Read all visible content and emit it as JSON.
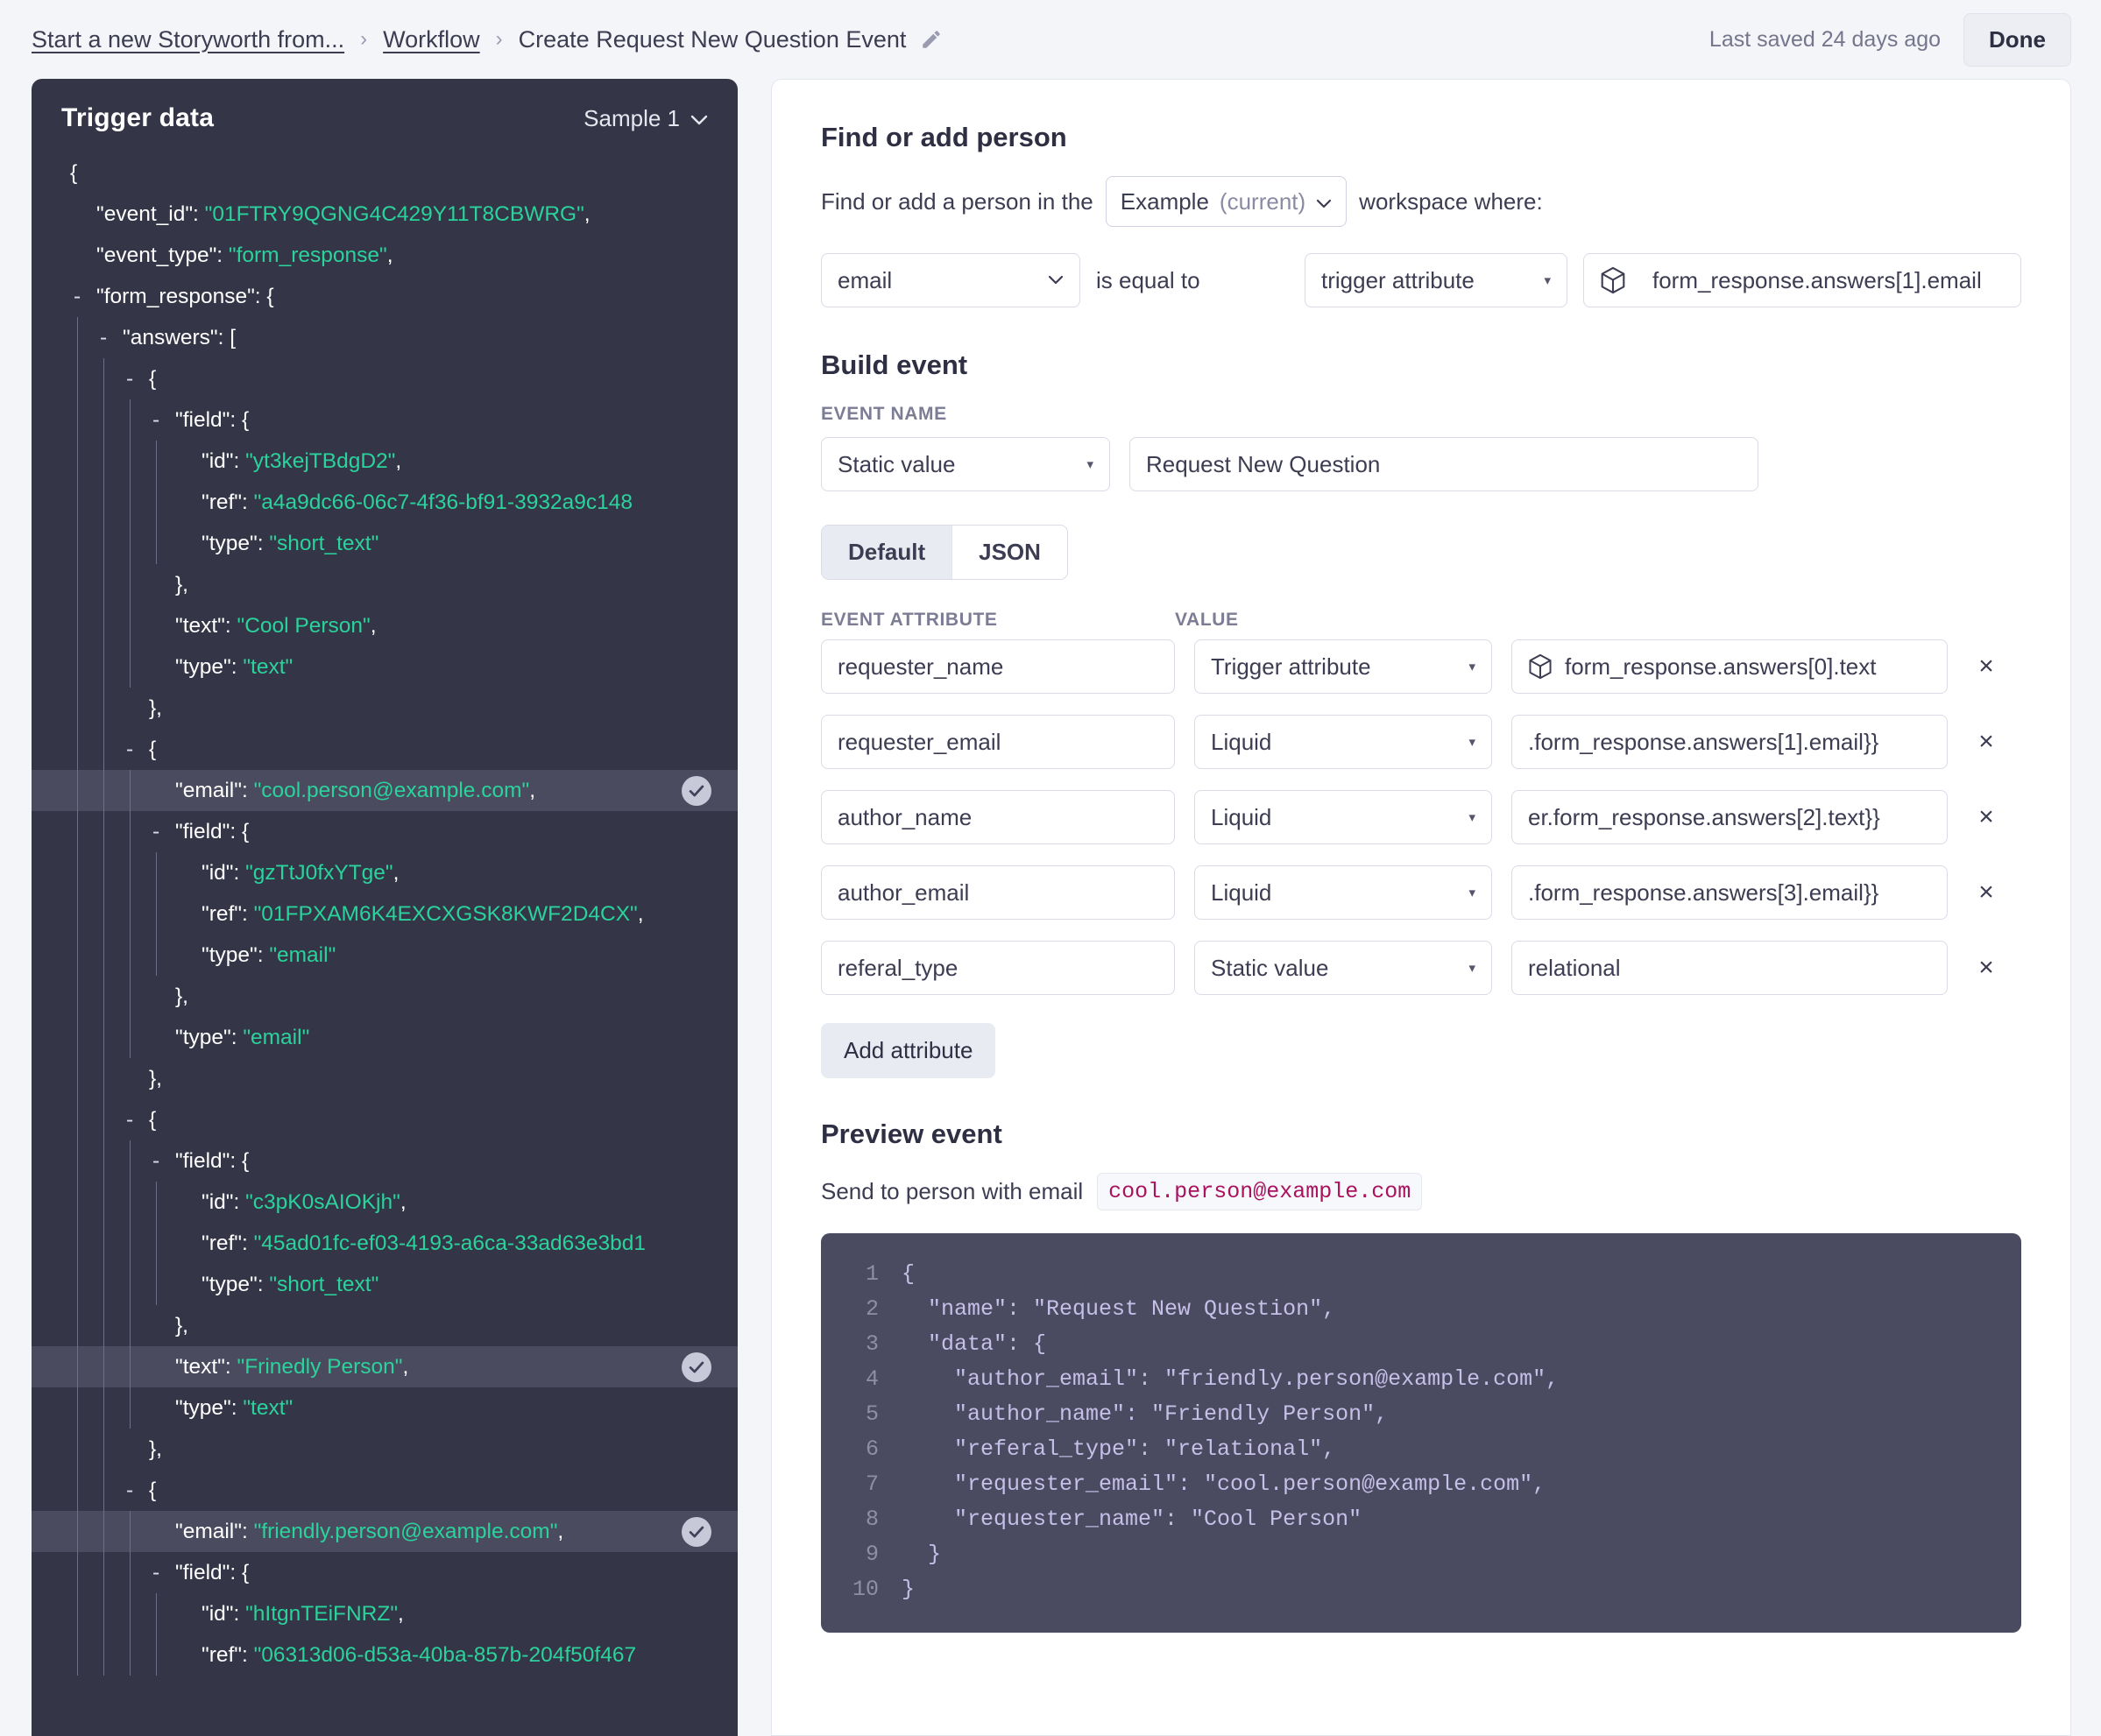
{
  "topbar": {
    "breadcrumb": [
      {
        "label": "Start a new Storyworth from...",
        "link": true
      },
      {
        "label": "Workflow",
        "link": true
      },
      {
        "label": "Create Request New Question Event",
        "link": false
      }
    ],
    "edit_icon": "pencil-icon",
    "saved_status": "Last saved 24 days ago",
    "done_label": "Done"
  },
  "trigger_panel": {
    "title": "Trigger data",
    "sample_label": "Sample 1",
    "chevron": "chevron-down-icon",
    "rows": [
      {
        "guides": 0,
        "dash": false,
        "segments": [
          {
            "t": "{",
            "c": "p"
          }
        ]
      },
      {
        "guides": 1,
        "dash": false,
        "segments": [
          {
            "t": "\"event_id\": ",
            "c": "k"
          },
          {
            "t": "\"01FTRY9QGNG4C429Y11T8CBWRG\"",
            "c": "v"
          },
          {
            "t": ",",
            "c": "p"
          }
        ]
      },
      {
        "guides": 1,
        "dash": false,
        "segments": [
          {
            "t": "\"event_type\": ",
            "c": "k"
          },
          {
            "t": "\"form_response\"",
            "c": "v"
          },
          {
            "t": ",",
            "c": "p"
          }
        ]
      },
      {
        "guides": 1,
        "dash": true,
        "segments": [
          {
            "t": "\"form_response\": {",
            "c": "k"
          }
        ]
      },
      {
        "guides": 2,
        "dash": true,
        "segments": [
          {
            "t": "\"answers\": [",
            "c": "k"
          }
        ]
      },
      {
        "guides": 3,
        "dash": true,
        "segments": [
          {
            "t": "{",
            "c": "p"
          }
        ]
      },
      {
        "guides": 4,
        "dash": true,
        "segments": [
          {
            "t": "\"field\": {",
            "c": "k"
          }
        ]
      },
      {
        "guides": 5,
        "dash": false,
        "segments": [
          {
            "t": "\"id\": ",
            "c": "k"
          },
          {
            "t": "\"yt3kejTBdgD2\"",
            "c": "v"
          },
          {
            "t": ",",
            "c": "p"
          }
        ]
      },
      {
        "guides": 5,
        "dash": false,
        "segments": [
          {
            "t": "\"ref\": ",
            "c": "k"
          },
          {
            "t": "\"a4a9dc66-06c7-4f36-bf91-3932a9c148",
            "c": "v"
          }
        ]
      },
      {
        "guides": 5,
        "dash": false,
        "segments": [
          {
            "t": "\"type\": ",
            "c": "k"
          },
          {
            "t": "\"short_text\"",
            "c": "v"
          }
        ]
      },
      {
        "guides": 4,
        "dash": false,
        "segments": [
          {
            "t": "},",
            "c": "p"
          }
        ]
      },
      {
        "guides": 4,
        "dash": false,
        "segments": [
          {
            "t": "\"text\": ",
            "c": "k"
          },
          {
            "t": "\"Cool Person\"",
            "c": "v"
          },
          {
            "t": ",",
            "c": "p"
          }
        ]
      },
      {
        "guides": 4,
        "dash": false,
        "segments": [
          {
            "t": "\"type\": ",
            "c": "k"
          },
          {
            "t": "\"text\"",
            "c": "v"
          }
        ]
      },
      {
        "guides": 3,
        "dash": false,
        "segments": [
          {
            "t": "},",
            "c": "p"
          }
        ]
      },
      {
        "guides": 3,
        "dash": true,
        "segments": [
          {
            "t": "{",
            "c": "p"
          }
        ]
      },
      {
        "guides": 4,
        "dash": false,
        "highlight": true,
        "check": true,
        "segments": [
          {
            "t": "\"email\": ",
            "c": "k"
          },
          {
            "t": "\"cool.person@example.com\"",
            "c": "v"
          },
          {
            "t": ",",
            "c": "p"
          }
        ]
      },
      {
        "guides": 4,
        "dash": true,
        "segments": [
          {
            "t": "\"field\": {",
            "c": "k"
          }
        ]
      },
      {
        "guides": 5,
        "dash": false,
        "segments": [
          {
            "t": "\"id\": ",
            "c": "k"
          },
          {
            "t": "\"gzTtJ0fxYTge\"",
            "c": "v"
          },
          {
            "t": ",",
            "c": "p"
          }
        ]
      },
      {
        "guides": 5,
        "dash": false,
        "segments": [
          {
            "t": "\"ref\": ",
            "c": "k"
          },
          {
            "t": "\"01FPXAM6K4EXCXGSK8KWF2D4CX\"",
            "c": "v"
          },
          {
            "t": ",",
            "c": "p"
          }
        ]
      },
      {
        "guides": 5,
        "dash": false,
        "segments": [
          {
            "t": "\"type\": ",
            "c": "k"
          },
          {
            "t": "\"email\"",
            "c": "v"
          }
        ]
      },
      {
        "guides": 4,
        "dash": false,
        "segments": [
          {
            "t": "},",
            "c": "p"
          }
        ]
      },
      {
        "guides": 4,
        "dash": false,
        "segments": [
          {
            "t": "\"type\": ",
            "c": "k"
          },
          {
            "t": "\"email\"",
            "c": "v"
          }
        ]
      },
      {
        "guides": 3,
        "dash": false,
        "segments": [
          {
            "t": "},",
            "c": "p"
          }
        ]
      },
      {
        "guides": 3,
        "dash": true,
        "segments": [
          {
            "t": "{",
            "c": "p"
          }
        ]
      },
      {
        "guides": 4,
        "dash": true,
        "segments": [
          {
            "t": "\"field\": {",
            "c": "k"
          }
        ]
      },
      {
        "guides": 5,
        "dash": false,
        "segments": [
          {
            "t": "\"id\": ",
            "c": "k"
          },
          {
            "t": "\"c3pK0sAIOKjh\"",
            "c": "v"
          },
          {
            "t": ",",
            "c": "p"
          }
        ]
      },
      {
        "guides": 5,
        "dash": false,
        "segments": [
          {
            "t": "\"ref\": ",
            "c": "k"
          },
          {
            "t": "\"45ad01fc-ef03-4193-a6ca-33ad63e3bd1",
            "c": "v"
          }
        ]
      },
      {
        "guides": 5,
        "dash": false,
        "segments": [
          {
            "t": "\"type\": ",
            "c": "k"
          },
          {
            "t": "\"short_text\"",
            "c": "v"
          }
        ]
      },
      {
        "guides": 4,
        "dash": false,
        "segments": [
          {
            "t": "},",
            "c": "p"
          }
        ]
      },
      {
        "guides": 4,
        "dash": false,
        "highlight": true,
        "check": true,
        "segments": [
          {
            "t": "\"text\": ",
            "c": "k"
          },
          {
            "t": "\"Frinedly Person\"",
            "c": "v"
          },
          {
            "t": ",",
            "c": "p"
          }
        ]
      },
      {
        "guides": 4,
        "dash": false,
        "segments": [
          {
            "t": "\"type\": ",
            "c": "k"
          },
          {
            "t": "\"text\"",
            "c": "v"
          }
        ]
      },
      {
        "guides": 3,
        "dash": false,
        "segments": [
          {
            "t": "},",
            "c": "p"
          }
        ]
      },
      {
        "guides": 3,
        "dash": true,
        "segments": [
          {
            "t": "{",
            "c": "p"
          }
        ]
      },
      {
        "guides": 4,
        "dash": false,
        "highlight": true,
        "check": true,
        "segments": [
          {
            "t": "\"email\": ",
            "c": "k"
          },
          {
            "t": "\"friendly.person@example.com\"",
            "c": "v"
          },
          {
            "t": ",",
            "c": "p"
          }
        ]
      },
      {
        "guides": 4,
        "dash": true,
        "segments": [
          {
            "t": "\"field\": {",
            "c": "k"
          }
        ]
      },
      {
        "guides": 5,
        "dash": false,
        "segments": [
          {
            "t": "\"id\": ",
            "c": "k"
          },
          {
            "t": "\"hItgnTEiFNRZ\"",
            "c": "v"
          },
          {
            "t": ",",
            "c": "p"
          }
        ]
      },
      {
        "guides": 5,
        "dash": false,
        "segments": [
          {
            "t": "\"ref\": ",
            "c": "k"
          },
          {
            "t": "\"06313d06-d53a-40ba-857b-204f50f467",
            "c": "v"
          }
        ]
      }
    ]
  },
  "find_person": {
    "heading": "Find or add person",
    "prefix_text": "Find or add a person in the",
    "workspace_name": "Example",
    "workspace_current": "(current)",
    "suffix_text": "workspace where:",
    "field": "email",
    "operator": "is equal to",
    "source_type": "trigger attribute",
    "value": "form_response.answers[1].email",
    "value_icon": "cube-icon"
  },
  "build_event": {
    "heading": "Build event",
    "event_name_label": "EVENT NAME",
    "event_name_type": "Static value",
    "event_name_value": "Request New Question",
    "toggle": {
      "options": [
        "Default",
        "JSON"
      ],
      "active": "Default"
    },
    "columns": {
      "attribute": "EVENT ATTRIBUTE",
      "value": "VALUE"
    },
    "attributes": [
      {
        "name": "requester_name",
        "type": "Trigger attribute",
        "value": "form_response.answers[0].text",
        "icon": "cube-icon",
        "remove": "×"
      },
      {
        "name": "requester_email",
        "type": "Liquid",
        "value": ".form_response.answers[1].email}}",
        "icon": null,
        "remove": "×"
      },
      {
        "name": "author_name",
        "type": "Liquid",
        "value": "er.form_response.answers[2].text}}",
        "icon": null,
        "remove": "×"
      },
      {
        "name": "author_email",
        "type": "Liquid",
        "value": ".form_response.answers[3].email}}",
        "icon": null,
        "remove": "×"
      },
      {
        "name": "referal_type",
        "type": "Static value",
        "value": "relational",
        "icon": null,
        "remove": "×"
      }
    ],
    "add_attribute_label": "Add attribute"
  },
  "preview": {
    "heading": "Preview event",
    "send_label": "Send to person with email",
    "send_email": "cool.person@example.com",
    "code_lines": [
      {
        "n": "1",
        "t": "{"
      },
      {
        "n": "2",
        "t": "  \"name\": \"Request New Question\","
      },
      {
        "n": "3",
        "t": "  \"data\": {"
      },
      {
        "n": "4",
        "t": "    \"author_email\": \"friendly.person@example.com\","
      },
      {
        "n": "5",
        "t": "    \"author_name\": \"Friendly Person\","
      },
      {
        "n": "6",
        "t": "    \"referal_type\": \"relational\","
      },
      {
        "n": "7",
        "t": "    \"requester_email\": \"cool.person@example.com\","
      },
      {
        "n": "8",
        "t": "    \"requester_name\": \"Cool Person\""
      },
      {
        "n": "9",
        "t": "  }"
      },
      {
        "n": "10",
        "t": "}"
      }
    ]
  },
  "colors": {
    "page_bg": "#f4f5f8",
    "panel_dark": "#353548",
    "highlight_row": "#4b4b60",
    "json_string": "#2ad39b",
    "code_bg": "#4a4a60",
    "code_text": "#c6bfe8",
    "pill_text": "#a8125f"
  }
}
